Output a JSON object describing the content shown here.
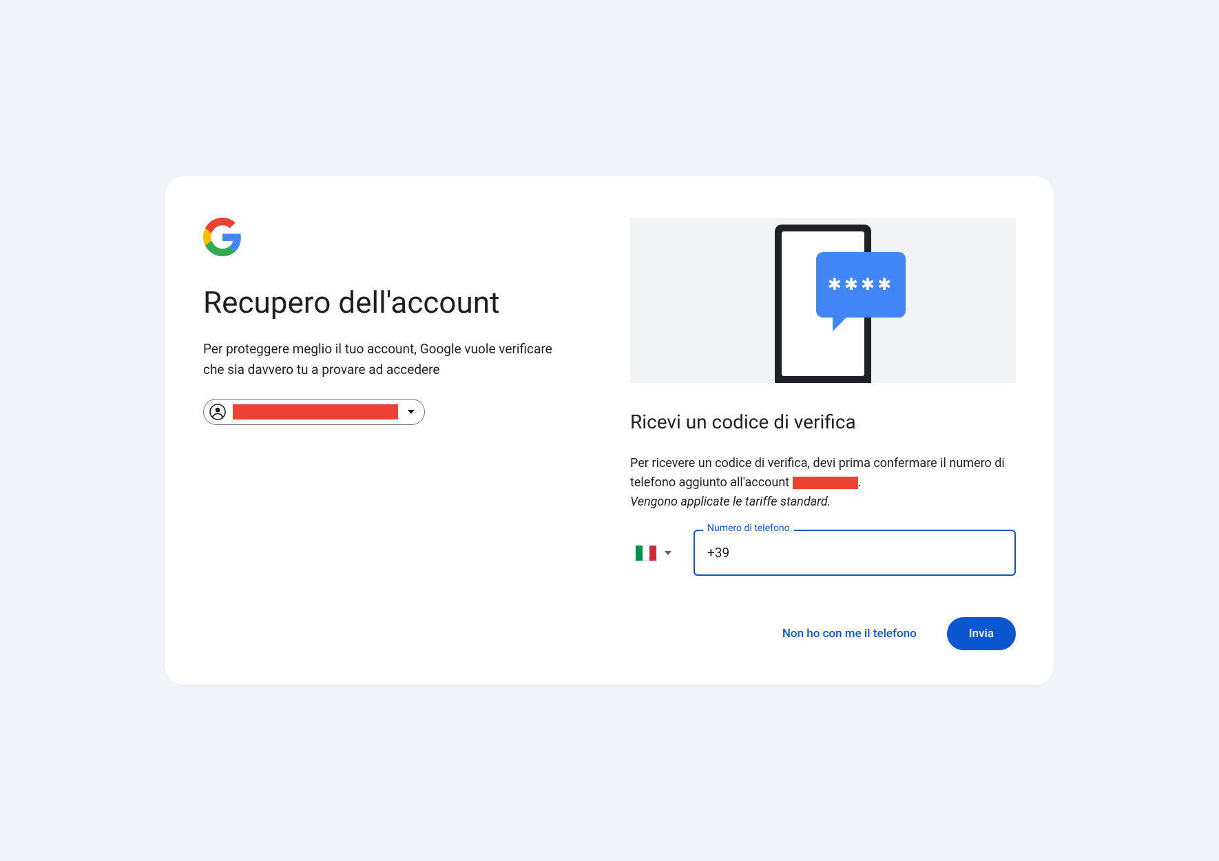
{
  "header": {
    "title": "Recupero dell'account",
    "subtitle": "Per proteggere meglio il tuo account, Google vuole verificare che sia davvero tu a provare ad accedere"
  },
  "account_chip": {
    "email_redacted": true
  },
  "section": {
    "title": "Ricevi un codice di verifica",
    "body_prefix": "Per ricevere un codice di verifica, devi prima confermare il numero di telefono aggiunto all'account ",
    "body_suffix": ".",
    "standard_rates": "Vengono applicate le tariffe standard."
  },
  "phone_input": {
    "label": "Numero di telefono",
    "value": "+39 ",
    "country_code": "IT",
    "country_flag": "italy"
  },
  "actions": {
    "no_phone": "Non ho con me il telefono",
    "submit": "Invia"
  },
  "illustration": {
    "stars": "✱✱✱✱"
  }
}
